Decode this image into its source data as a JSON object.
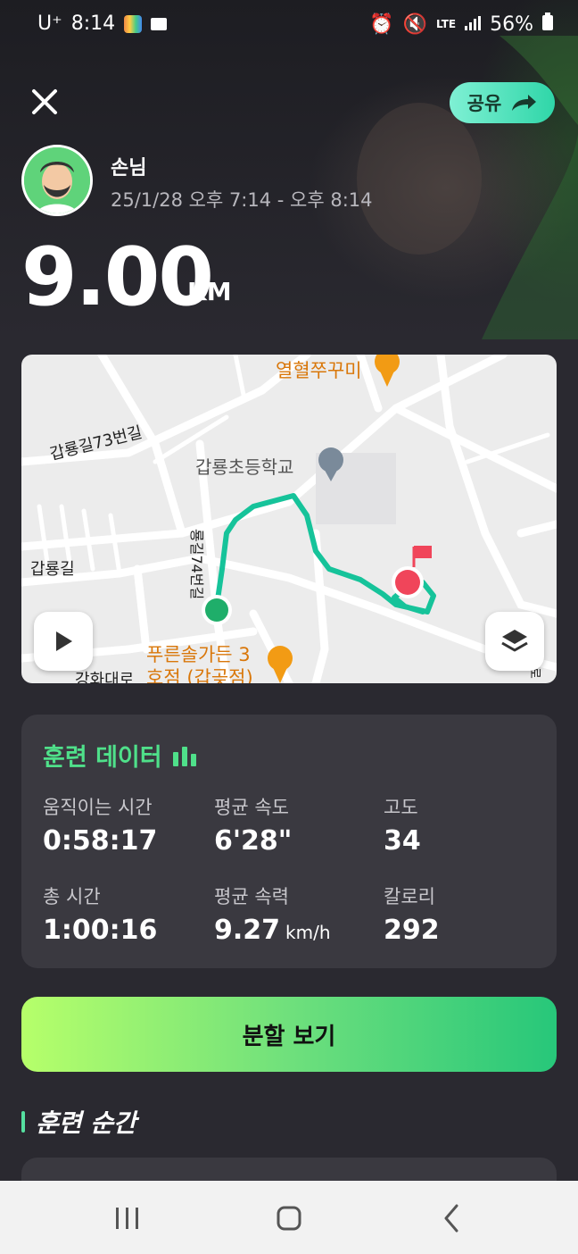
{
  "status_bar": {
    "carrier": "U⁺",
    "time": "8:14",
    "network": "LTE",
    "battery": "56%"
  },
  "header": {
    "share_label": "공유"
  },
  "user": {
    "name": "손님",
    "time_range": "25/1/28 오후 7:14 - 오후 8:14"
  },
  "summary": {
    "distance": "9.00",
    "unit": "KM"
  },
  "map": {
    "labels": {
      "road1": "갑룡길73번길",
      "road2": "갑룡길",
      "road3": "룡길74번길",
      "road4": "강화대로",
      "road5": "로"
    },
    "pois": {
      "school": "갑룡초등학교",
      "restaurant1": "열혈쭈꾸미",
      "restaurant2_line1": "푸른솔가든 3",
      "restaurant2_line2": "호점 (갑곶점)"
    }
  },
  "training_data": {
    "title": "훈련 데이터",
    "stats": [
      {
        "label": "움직이는 시간",
        "value": "0:58:17",
        "unit": ""
      },
      {
        "label": "평균 속도",
        "value": "6'28\"",
        "unit": ""
      },
      {
        "label": "고도",
        "value": "34",
        "unit": ""
      },
      {
        "label": "총 시간",
        "value": "1:00:16",
        "unit": ""
      },
      {
        "label": "평균 속력",
        "value": "9.27",
        "unit": "km/h"
      },
      {
        "label": "칼로리",
        "value": "292",
        "unit": ""
      }
    ]
  },
  "split_button": {
    "label": "분할 보기"
  },
  "section": {
    "title": "훈련 순간"
  },
  "colors": {
    "background": "#2a2930",
    "accent_green": "#4fe08a",
    "route": "#16c39a",
    "start_marker": "#1fae6a",
    "end_marker": "#f0455a"
  }
}
